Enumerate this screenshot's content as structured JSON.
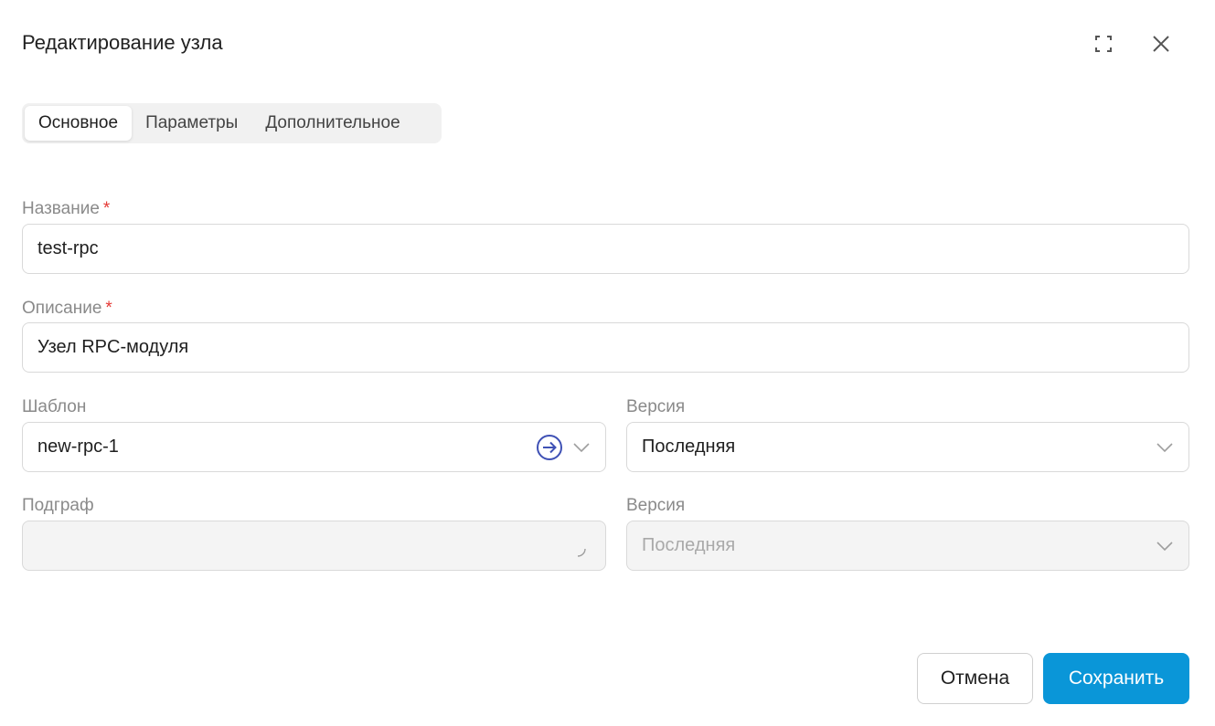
{
  "dialog": {
    "title": "Редактирование узла"
  },
  "tabs": [
    {
      "label": "Основное",
      "active": true
    },
    {
      "label": "Параметры",
      "active": false
    },
    {
      "label": "Дополнительное",
      "active": false
    }
  ],
  "form": {
    "name": {
      "label": "Название",
      "required_mark": "*",
      "value": "test-rpc"
    },
    "description": {
      "label": "Описание",
      "required_mark": "*",
      "value": "Узел RPC-модуля"
    },
    "template": {
      "label": "Шаблон",
      "value": "new-rpc-1"
    },
    "template_version": {
      "label": "Версия",
      "value": "Последняя"
    },
    "subgraph": {
      "label": "Подграф",
      "value": ""
    },
    "subgraph_version": {
      "label": "Версия",
      "value": "Последняя"
    }
  },
  "actions": {
    "cancel_label": "Отмена",
    "save_label": "Сохранить"
  },
  "colors": {
    "primary": "#0a96d8",
    "required": "#e53935",
    "link_icon": "#3f51b5"
  },
  "icons": {
    "expand": "fullscreen-icon",
    "close": "close-icon",
    "navigate": "arrow-right-circle-icon",
    "dropdown": "chevron-down-icon",
    "loading": "spinner-icon"
  }
}
